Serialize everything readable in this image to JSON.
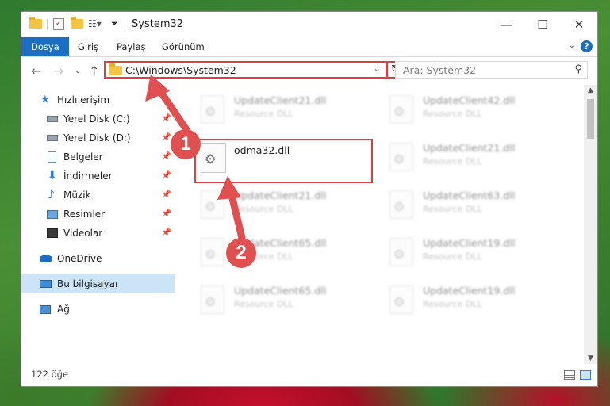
{
  "window": {
    "title": "System32"
  },
  "ribbon": {
    "tabs": [
      "Dosya",
      "Giriş",
      "Paylaş",
      "Görünüm"
    ],
    "help": "?"
  },
  "address": {
    "path": "C:\\Windows\\System32"
  },
  "search": {
    "placeholder": "Ara: System32"
  },
  "sidebar": {
    "items": [
      {
        "label": "Hızlı erişim",
        "icon": "star-icon"
      },
      {
        "label": "Yerel Disk (C:)",
        "icon": "drive-icon"
      },
      {
        "label": "Yerel Disk (D:)",
        "icon": "drive-icon"
      },
      {
        "label": "Belgeler",
        "icon": "documents-icon"
      },
      {
        "label": "İndirmeler",
        "icon": "downloads-icon"
      },
      {
        "label": "Müzik",
        "icon": "music-icon"
      },
      {
        "label": "Resimler",
        "icon": "pictures-icon"
      },
      {
        "label": "Videolar",
        "icon": "videos-icon"
      },
      {
        "label": "OneDrive",
        "icon": "cloud-icon"
      },
      {
        "label": "Bu bilgisayar",
        "icon": "computer-icon"
      },
      {
        "label": "Ağ",
        "icon": "network-icon"
      }
    ]
  },
  "files": {
    "items": [
      {
        "name": "UpdateClient21.dll",
        "type": "Resource DLL"
      },
      {
        "name": "UpdateClient42.dll",
        "type": "Resource DLL"
      },
      {
        "name": "odma32.dll",
        "type": ""
      },
      {
        "name": "UpdateClient21.dll",
        "type": "Resource DLL"
      },
      {
        "name": "UpdateClient21.dll",
        "type": "Resource DLL"
      },
      {
        "name": "UpdateClient63.dll",
        "type": "Resource DLL"
      },
      {
        "name": "UpdateClient65.dll",
        "type": "Resource DLL"
      },
      {
        "name": "UpdateClient19.dll",
        "type": "Resource DLL"
      },
      {
        "name": "UpdateClient65.dll",
        "type": "Resource DLL"
      },
      {
        "name": "UpdateClient19.dll",
        "type": "Resource DLL"
      }
    ]
  },
  "status": {
    "count": "122 öğe"
  },
  "annotations": {
    "badge1": "1",
    "badge2": "2",
    "color": "#e05050"
  }
}
